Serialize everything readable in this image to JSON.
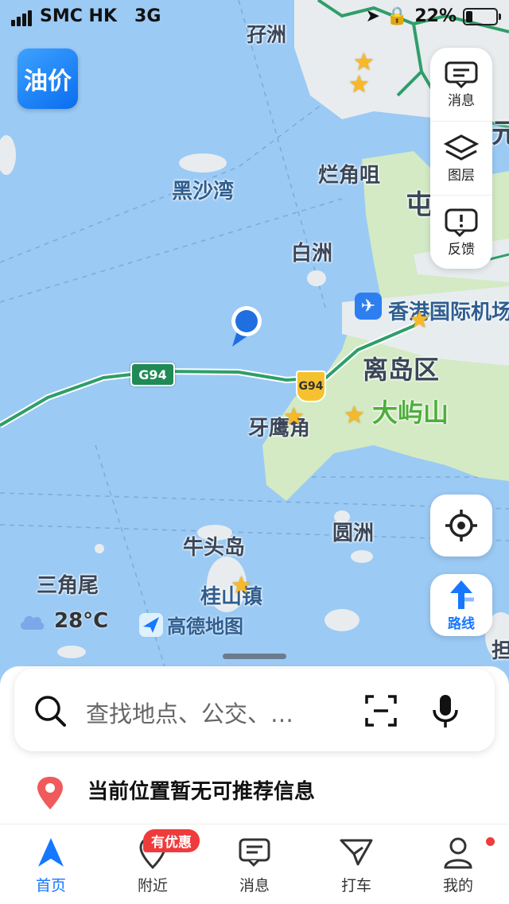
{
  "status_bar": {
    "carrier": "SMC HK",
    "network": "3G",
    "battery": "22%"
  },
  "quick_app": {
    "label": "油价"
  },
  "map": {
    "labels": {
      "zi_zhou": "孖洲",
      "hei_sha_wan": "黑沙湾",
      "lan_jiao_ju": "烂角咀",
      "bai_zhou": "白洲",
      "airport": "香港国际机场",
      "district": "离岛区",
      "da_yu_shan": "大屿山",
      "ya_ying_jiao": "牙鹰角",
      "niu_tou_dao": "牛头岛",
      "yuan_zhou": "圆洲",
      "san_jiao_wei": "三角尾",
      "gui_shan_zhen": "桂山镇",
      "partial_zhong": "屯",
      "partial_yuan": "元",
      "partial_dan": "担",
      "highway_1": "G94",
      "highway_2": "G94"
    }
  },
  "side_panel": {
    "messages": "消息",
    "layers": "图层",
    "feedback": "反馈"
  },
  "route_button": {
    "label": "路线"
  },
  "weather": {
    "temperature": "28°C"
  },
  "brand": {
    "name": "高德地图"
  },
  "search": {
    "placeholder": "查找地点、公交、…"
  },
  "info": {
    "text": "当前位置暂无可推荐信息"
  },
  "tabbar": {
    "promo_badge": "有优惠",
    "tabs": [
      "首页",
      "附近",
      "消息",
      "打车",
      "我的"
    ]
  },
  "colors": {
    "accent": "#1677ff",
    "water": "#9bcaf4",
    "land": "#d3eac4",
    "road": "#2f9e6a",
    "badge": "#ef3b3b"
  }
}
